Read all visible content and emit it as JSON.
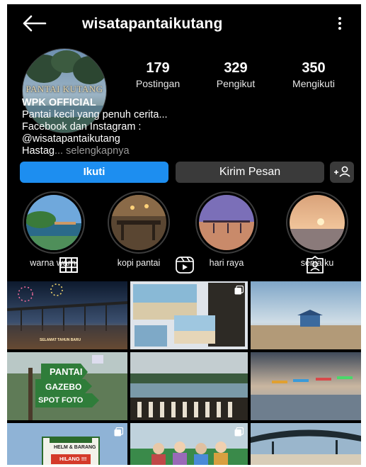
{
  "profile": {
    "username": "wisatapantaikutang",
    "avatar_text": "PANTAI KUTANG",
    "stats": [
      {
        "value": "179",
        "label": "Postingan"
      },
      {
        "value": "329",
        "label": "Pengikut"
      },
      {
        "value": "350",
        "label": "Mengikuti"
      }
    ],
    "bio": {
      "name": "WPK OFFICIAL",
      "line1": "Pantai kecil yang penuh cerita...",
      "line2": "Facebook dan Instagram :",
      "line3": "@wisatapantaikutang",
      "line4": "Hastag",
      "more": "... selengkapnya"
    }
  },
  "actions": {
    "follow": "Ikuti",
    "message": "Kirim Pesan"
  },
  "highlights": [
    {
      "label": "warna warni"
    },
    {
      "label": "kopi pantai"
    },
    {
      "label": "hari raya"
    },
    {
      "label": "senja ku"
    }
  ],
  "tabs": [
    "grid-icon",
    "reels-icon",
    "tagged-icon"
  ],
  "posts": {
    "p1_caption": "SELAMAT TAHUN BARU",
    "p5_sign1": "PANTAI",
    "p5_sign2": "GAZEBO",
    "p5_sign3": "SPOT FOTO",
    "p7_sign1": "HELM & BARANG",
    "p7_sign2": "HILANG !!!"
  },
  "colors": {
    "background": "#000000",
    "follow_button": "#1d8ef0",
    "secondary_button": "#3a3a3a"
  }
}
